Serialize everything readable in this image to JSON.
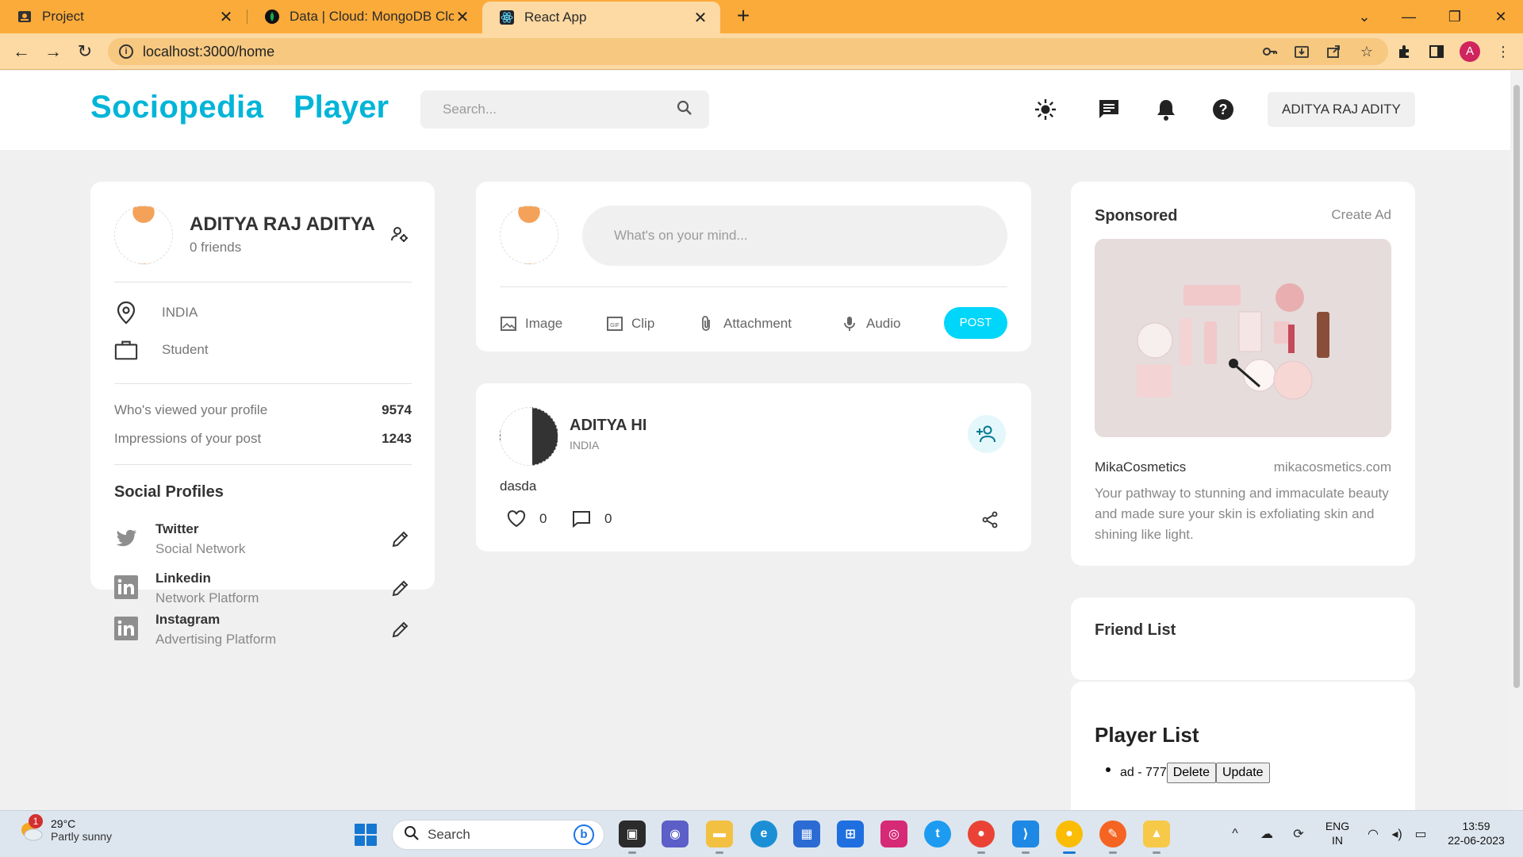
{
  "browser": {
    "tabs": [
      {
        "title": "Project",
        "favicon": "person-card-icon"
      },
      {
        "title": "Data | Cloud: MongoDB Cloud",
        "favicon": "mongodb-leaf-icon"
      },
      {
        "title": "React App",
        "favicon": "react-icon",
        "active": true
      }
    ],
    "url": "localhost:3000/home",
    "profile_initial": "A"
  },
  "app": {
    "brand": "Sociopedia",
    "brand_secondary": "Player",
    "search_placeholder": "Search...",
    "user_select": "ADITYA RAJ ADITY",
    "user_widget": {
      "name": "ADITYA RAJ ADITYA",
      "friends": "0 friends",
      "location": "INDIA",
      "occupation": "Student",
      "stats": [
        {
          "label": "Who's viewed your profile",
          "value": "9574"
        },
        {
          "label": "Impressions of your post",
          "value": "1243"
        }
      ],
      "social_title": "Social Profiles",
      "socials": [
        {
          "name": "Twitter",
          "sub": "Social Network",
          "icon": "twitter-icon"
        },
        {
          "name": "Linkedin",
          "sub": "Network Platform",
          "icon": "linkedin-icon"
        },
        {
          "name": "Instagram",
          "sub": "Advertising Platform",
          "icon": "linkedin-icon"
        }
      ]
    },
    "composer": {
      "placeholder": "What's on your mind...",
      "actions": [
        "Image",
        "Clip",
        "Attachment",
        "Audio"
      ],
      "post_label": "POST"
    },
    "post": {
      "name": "ADITYA HI",
      "location": "INDIA",
      "description": "dasda",
      "likes": "0",
      "comments": "0"
    },
    "sponsored": {
      "title": "Sponsored",
      "create": "Create Ad",
      "brand": "MikaCosmetics",
      "site": "mikacosmetics.com",
      "description": "Your pathway to stunning and immaculate beauty and made sure your skin is exfoliating skin and shining like light."
    },
    "friend_list_title": "Friend List",
    "player_list": {
      "title": "Player List",
      "items": [
        {
          "text": "ad - 777",
          "delete": "Delete",
          "update": "Update"
        }
      ]
    },
    "accent_color": "#00b5d8"
  },
  "taskbar": {
    "temperature": "29°C",
    "condition": "Partly sunny",
    "weather_badge": "1",
    "search": "Search",
    "lang": "ENG",
    "region": "IN",
    "time": "13:59",
    "date": "22-06-2023"
  }
}
